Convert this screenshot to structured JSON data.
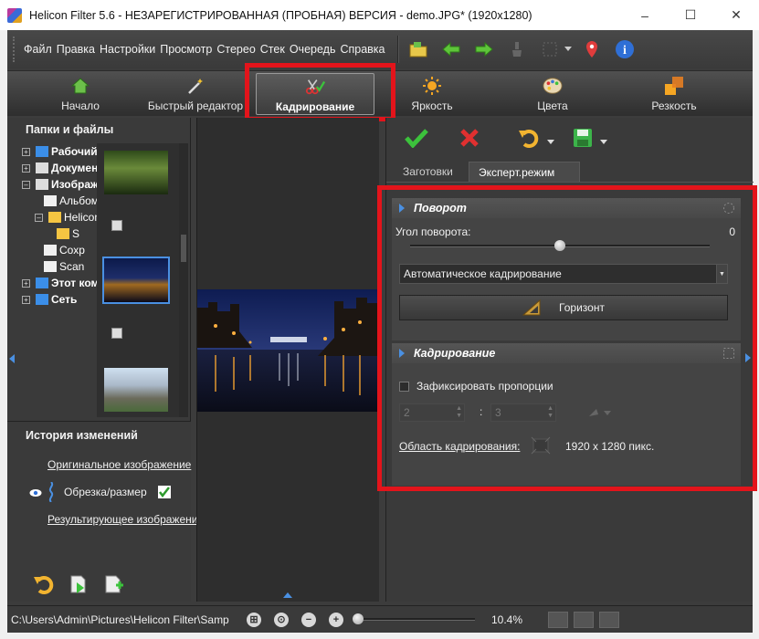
{
  "window": {
    "title": "Helicon Filter 5.6 - НЕЗАРЕГИСТРИРОВАННАЯ (ПРОБНАЯ) ВЕРСИЯ - demo.JPG* (1920x1280)",
    "controls": [
      "–",
      "☐",
      "✕"
    ]
  },
  "menu": {
    "items": [
      "Файл",
      "Правка",
      "Настройки",
      "Просмотр",
      "Стерео",
      "Стек",
      "Очередь",
      "Справка"
    ]
  },
  "module_tabs": [
    {
      "label": "Начало",
      "icon": "home-icon"
    },
    {
      "label": "Быстрый редактор",
      "icon": "magic-wand-icon"
    },
    {
      "label": "Кадрирование",
      "icon": "crop-scissors-icon",
      "active": true
    },
    {
      "label": "Яркость",
      "icon": "sun-icon"
    },
    {
      "label": "Цвета",
      "icon": "palette-icon"
    },
    {
      "label": "Резкость",
      "icon": "sharpness-icon"
    }
  ],
  "folders": {
    "title": "Папки и файлы",
    "tree": [
      {
        "pm": "+",
        "label": "Рабочий",
        "bold": true,
        "color": "#3b8ee8"
      },
      {
        "pm": "+",
        "label": "Документы",
        "bold": true,
        "color": "#dddddd"
      },
      {
        "pm": "–",
        "label": "Изображения",
        "bold": true,
        "color": "#dddddd"
      },
      {
        "pm": "",
        "label": "Альбом",
        "bold": false,
        "color": "#f0f0f0"
      },
      {
        "pm": "–",
        "label": "Helicon",
        "bold": false,
        "color": "#f5c542"
      },
      {
        "pm": "",
        "label": "S",
        "bold": false,
        "color": "#f5c542"
      },
      {
        "pm": "",
        "label": "Сохр",
        "bold": false,
        "color": "#f0f0f0"
      },
      {
        "pm": "",
        "label": "Scan",
        "bold": false,
        "color": "#f0f0f0"
      },
      {
        "pm": "+",
        "label": "Этот компьютер",
        "bold": true,
        "color": "#3b8ee8"
      },
      {
        "pm": "+",
        "label": "Сеть",
        "bold": true,
        "color": "#3b8ee8"
      }
    ]
  },
  "history": {
    "title": "История изменений",
    "original": "Оригинальное изображение",
    "step": "Обрезка/размер",
    "result": "Результирующее изображение"
  },
  "right": {
    "subtabs": [
      "Заготовки",
      "Эксперт.режим"
    ],
    "rotation": {
      "title": "Поворот",
      "angle_label": "Угол поворота:",
      "angle_value": "0",
      "angle_fraction": 0.5,
      "auto_crop": "Автоматическое кадрирование",
      "horizon_button": "Горизонт"
    },
    "crop": {
      "title": "Кадрирование",
      "fix_proportions": "Зафиксировать пропорции",
      "ratio_w": "2",
      "ratio_sep": ":",
      "ratio_h": "3",
      "area_label": "Область кадрирования:",
      "area_value": "1920 x 1280 пикс."
    }
  },
  "status": {
    "path": "C:\\Users\\Admin\\Pictures\\Helicon Filter\\Samp",
    "zoom": "10.4%"
  },
  "colors": {
    "highlight_red": "#e3141b",
    "accept_green": "#3cc23c",
    "cancel_red": "#e03030",
    "link_blue": "#4a90e2"
  }
}
